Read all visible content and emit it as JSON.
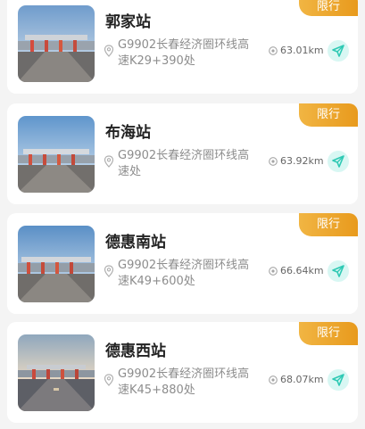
{
  "stations": [
    {
      "name": "郭家站",
      "address": "G9902长春经济圈环线高速K29+390处",
      "distance": "63.01km",
      "badge": "限行",
      "image": "toll-station-photo",
      "sky": "#c9d7e6"
    },
    {
      "name": "布海站",
      "address": "G9902长春经济圈环线高速处",
      "distance": "63.92km",
      "badge": "限行",
      "image": "toll-station-photo",
      "sky": "#bcd2e6"
    },
    {
      "name": "德惠南站",
      "address": "G9902长春经济圈环线高速K49+600处",
      "distance": "66.64km",
      "badge": "限行",
      "image": "toll-station-photo",
      "sky": "#b9cee2"
    },
    {
      "name": "德惠西站",
      "address": "G9902长春经济圈环线高速K45+880处",
      "distance": "68.07km",
      "badge": "限行",
      "image": "toll-station-photo",
      "sky": "#cdd3d8"
    }
  ],
  "colors": {
    "badge": "#e89a1d",
    "nav_bg": "#d8f7f3",
    "nav_icon": "#2ec9b4",
    "title": "#222222",
    "address": "#8d8d8d"
  },
  "icons": {
    "location": "location-pin-icon",
    "distance": "distance-pin-icon",
    "navigate": "navigate-arrow-icon"
  }
}
